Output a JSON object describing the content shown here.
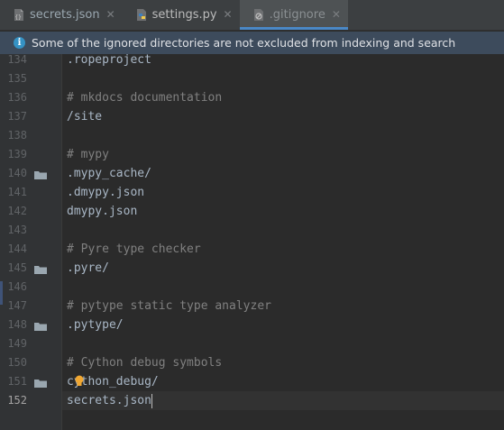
{
  "tabs": [
    {
      "label": "secrets.json",
      "icon": "json-file-icon",
      "active": false
    },
    {
      "label": "settings.py",
      "icon": "python-file-icon",
      "active": false
    },
    {
      "label": ".gitignore",
      "icon": "gitignore-file-icon",
      "active": true
    }
  ],
  "close_glyph": "✕",
  "notification": {
    "icon": "info-icon",
    "text": "Some of the ignored directories are not excluded from indexing and search"
  },
  "editor": {
    "current_line": "152",
    "lines": [
      {
        "num": "134",
        "text": ".ropeproject",
        "type": "path"
      },
      {
        "num": "135",
        "text": "",
        "type": "empty"
      },
      {
        "num": "136",
        "text": "# mkdocs documentation",
        "type": "comment"
      },
      {
        "num": "137",
        "text": "/site",
        "type": "path"
      },
      {
        "num": "138",
        "text": "",
        "type": "empty"
      },
      {
        "num": "139",
        "text": "# mypy",
        "type": "comment"
      },
      {
        "num": "140",
        "text": ".mypy_cache/",
        "type": "path",
        "folder": true
      },
      {
        "num": "141",
        "text": ".dmypy.json",
        "type": "path"
      },
      {
        "num": "142",
        "text": "dmypy.json",
        "type": "path"
      },
      {
        "num": "143",
        "text": "",
        "type": "empty"
      },
      {
        "num": "144",
        "text": "# Pyre type checker",
        "type": "comment"
      },
      {
        "num": "145",
        "text": ".pyre/",
        "type": "path",
        "folder": true
      },
      {
        "num": "146",
        "text": "",
        "type": "empty"
      },
      {
        "num": "147",
        "text": "# pytype static type analyzer",
        "type": "comment"
      },
      {
        "num": "148",
        "text": ".pytype/",
        "type": "path",
        "folder": true
      },
      {
        "num": "149",
        "text": "",
        "type": "empty"
      },
      {
        "num": "150",
        "text": "# Cython debug symbols",
        "type": "comment"
      },
      {
        "num": "151",
        "text": "cython_debug/",
        "type": "path",
        "folder": true
      },
      {
        "num": "152",
        "text": "secrets.json",
        "type": "path",
        "current": true
      }
    ]
  },
  "colors": {
    "accent": "#4a88c7",
    "comment": "#808080",
    "text": "#a9b7c6",
    "bulb": "#f0a732",
    "folder": "#9aa7b0"
  }
}
